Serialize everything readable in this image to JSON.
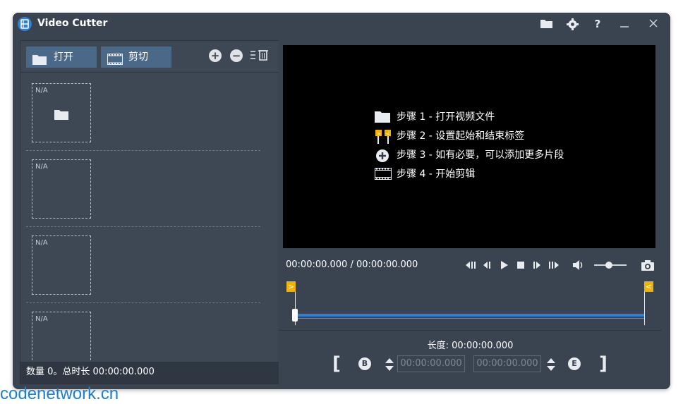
{
  "window": {
    "title": "Video Cutter"
  },
  "title_icons": [
    "folder-icon",
    "gear-icon",
    "help-icon",
    "minimize-icon",
    "close-icon"
  ],
  "toolbar": {
    "open_label": "打开",
    "cut_label": "剪切"
  },
  "thumbs": [
    {
      "label": "N/A"
    },
    {
      "label": "N/A"
    },
    {
      "label": "N/A"
    },
    {
      "label": "N/A"
    }
  ],
  "status": {
    "text": "数量 0。总时长 00:00:00.000"
  },
  "steps": [
    {
      "icon": "folder-icon",
      "text": "步骤 1 - 打开视频文件"
    },
    {
      "icon": "markers-icon",
      "text": "步骤 2 - 设置起始和结束标签"
    },
    {
      "icon": "add-icon",
      "text": "步骤 3 - 如有必要，可以添加更多片段"
    },
    {
      "icon": "film-icon",
      "text": "步骤 4 - 开始剪辑"
    }
  ],
  "player": {
    "time": "00:00:00.000 / 00:00:00.000"
  },
  "timeline": {
    "start_marker": ">",
    "end_marker": "<"
  },
  "segment": {
    "length_label": "长度: 00:00:00.000",
    "start_placeholder": "00:00:00.000",
    "end_placeholder": "00:00:00.000",
    "start_letter": "B",
    "end_letter": "E",
    "left_bracket": "[",
    "right_bracket": "]"
  },
  "watermark": "codenetwork.cn",
  "colors": {
    "window_bg": "#3a4350",
    "button_bg": "#4a6888",
    "video_bg": "#000000",
    "timeline": "#2f7fd8",
    "marker": "#f0b400"
  }
}
